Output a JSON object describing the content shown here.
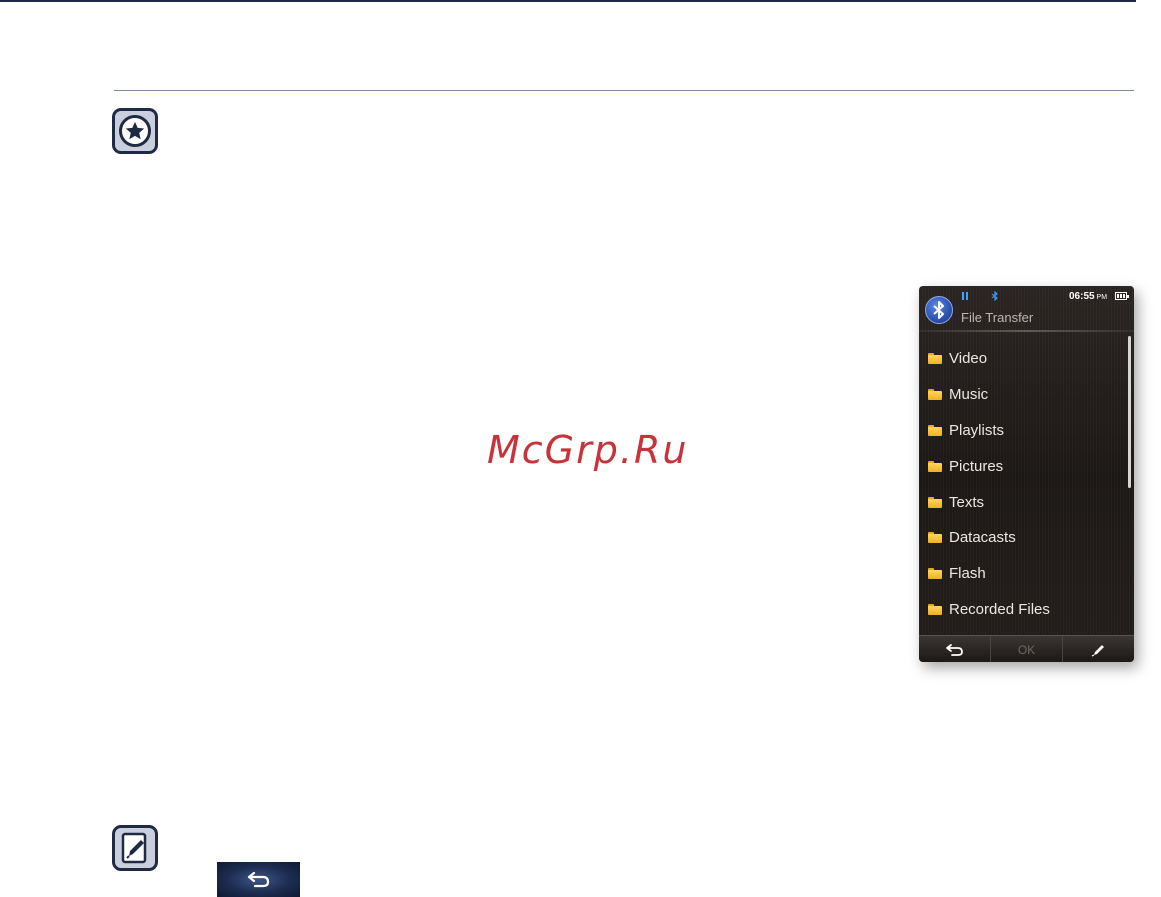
{
  "watermark": {
    "text": "McGrp.Ru"
  },
  "device": {
    "status": {
      "time": "06:55",
      "ampm": "PM"
    },
    "title": "File Transfer",
    "folders": [
      {
        "label": "Video"
      },
      {
        "label": "Music"
      },
      {
        "label": "Playlists"
      },
      {
        "label": "Pictures"
      },
      {
        "label": "Texts"
      },
      {
        "label": "Datacasts"
      },
      {
        "label": "Flash"
      },
      {
        "label": "Recorded Files"
      }
    ],
    "bottom_bar": {
      "ok_label": "OK"
    }
  },
  "icons": {
    "tip": "star-icon",
    "note": "pencil-icon",
    "back": "back-arrow-icon",
    "bluetooth": "bluetooth-icon",
    "folder": "folder-icon",
    "edit": "edit-pen-icon"
  },
  "colors": {
    "navy": "#1f2a44",
    "folder_yellow": "#f0b020",
    "bluetooth_blue": "#2c52b0",
    "watermark_red": "#c8323a"
  }
}
